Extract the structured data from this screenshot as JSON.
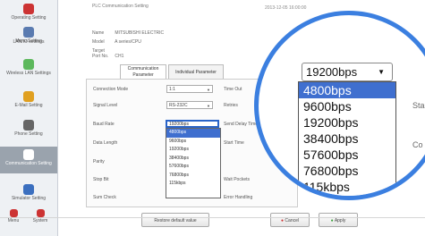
{
  "sidebar": {
    "items": [
      {
        "label": "Operating Setting",
        "icon": "operation-icon",
        "color": "#cc3333"
      },
      {
        "label": "Menu Setting",
        "icon": "menu-icon",
        "color": "#5a7bb0"
      },
      {
        "label": "LAN/IO settings",
        "icon": "lan-icon",
        "color": "#888888"
      },
      {
        "label": "Wireless LAN Settings",
        "icon": "wireless-icon",
        "color": "#5cb85c"
      },
      {
        "label": "E-Mail Setting",
        "icon": "mail-icon",
        "color": "#e0a020"
      },
      {
        "label": "Phone Setting",
        "icon": "phone-icon",
        "color": "#666666"
      },
      {
        "label": "Communication Setting",
        "icon": "communication-icon",
        "color": "#ffffff"
      },
      {
        "label": "Simulator Setting",
        "icon": "simulator-icon",
        "color": "#3b6fbf"
      },
      {
        "label": "Menu",
        "icon": "home-icon",
        "color": "#cc3333"
      },
      {
        "label": "System",
        "icon": "system-icon",
        "color": "#cc3333"
      }
    ]
  },
  "header": {
    "title": "PLC Communication Setting",
    "date": "2013-12-05 16:00:00"
  },
  "meta": [
    {
      "key": "Name",
      "value": "MITSUBISHI ELECTRIC"
    },
    {
      "key": "Model",
      "value": "A series/CPU"
    },
    {
      "key": "Target Port No.",
      "value": "CH1"
    }
  ],
  "tabs": [
    {
      "label": "Communication Parameter"
    },
    {
      "label": "Individual Parameter"
    }
  ],
  "form": {
    "connection_mode": {
      "label": "Connection Mode",
      "value": "1:1"
    },
    "time_out": {
      "label": "Time Out"
    },
    "signal_level": {
      "label": "Signal Level",
      "value": "RS-232C"
    },
    "retries": {
      "label": "Retries"
    },
    "baud_rate": {
      "label": "Baud Rate",
      "value": "19200bps"
    },
    "send_delay": {
      "label": "Send Delay Time"
    },
    "data_length": {
      "label": "Data Length"
    },
    "start_time": {
      "label": "Start Time"
    },
    "parity": {
      "label": "Parity"
    },
    "stop_bit": {
      "label": "Stop Bit"
    },
    "sum_check": {
      "label": "Sum Check"
    },
    "wait_pockets": {
      "label": "Wait Pockets"
    },
    "error_handling": {
      "label": "Error Handling"
    }
  },
  "baud_options": [
    "4800bps",
    "9600bps",
    "19200bps",
    "38400bps",
    "57600bps",
    "76800bps",
    "115kbps"
  ],
  "selected_option": "4800bps",
  "buttons": {
    "restore": "Restore default value",
    "cancel": "Cancel",
    "apply": "Apply"
  },
  "magnifier": {
    "head_value": "19200bps",
    "side_labels": [
      "Sta",
      "Co"
    ]
  }
}
